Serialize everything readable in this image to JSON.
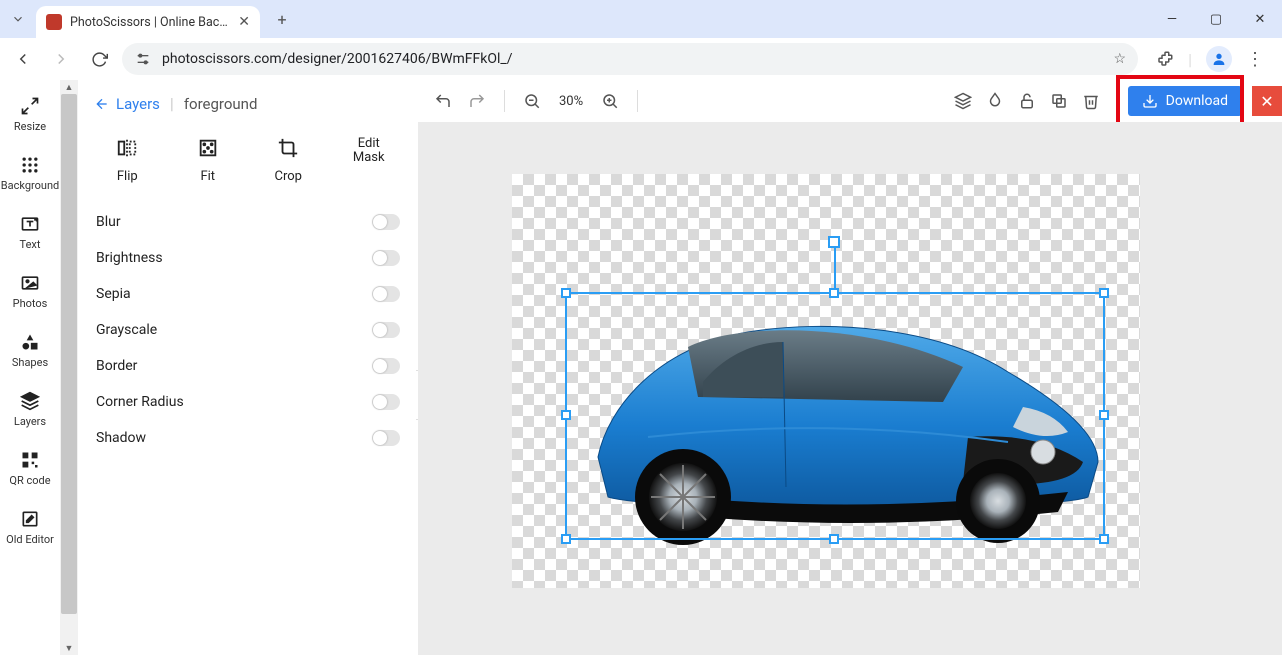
{
  "browser": {
    "tab_title": "PhotoScissors | Online Backgro",
    "url": "photoscissors.com/designer/2001627406/BWmFFkOl_/"
  },
  "left_rail": [
    {
      "icon": "resize",
      "label": "Resize"
    },
    {
      "icon": "grid",
      "label": "Background"
    },
    {
      "icon": "text",
      "label": "Text"
    },
    {
      "icon": "image",
      "label": "Photos"
    },
    {
      "icon": "shapes",
      "label": "Shapes"
    },
    {
      "icon": "layers",
      "label": "Layers"
    },
    {
      "icon": "qr",
      "label": "QR code"
    },
    {
      "icon": "edit",
      "label": "Old Editor"
    }
  ],
  "panel": {
    "back_label": "Layers",
    "current": "foreground",
    "tools": [
      {
        "label": "Flip"
      },
      {
        "label": "Fit"
      },
      {
        "label": "Crop"
      },
      {
        "label": "Edit Mask"
      }
    ],
    "options": [
      {
        "label": "Blur",
        "on": false
      },
      {
        "label": "Brightness",
        "on": false
      },
      {
        "label": "Sepia",
        "on": false
      },
      {
        "label": "Grayscale",
        "on": false
      },
      {
        "label": "Border",
        "on": false
      },
      {
        "label": "Corner Radius",
        "on": false
      },
      {
        "label": "Shadow",
        "on": false
      }
    ]
  },
  "toolbar": {
    "zoom": "30%",
    "download": "Download"
  }
}
